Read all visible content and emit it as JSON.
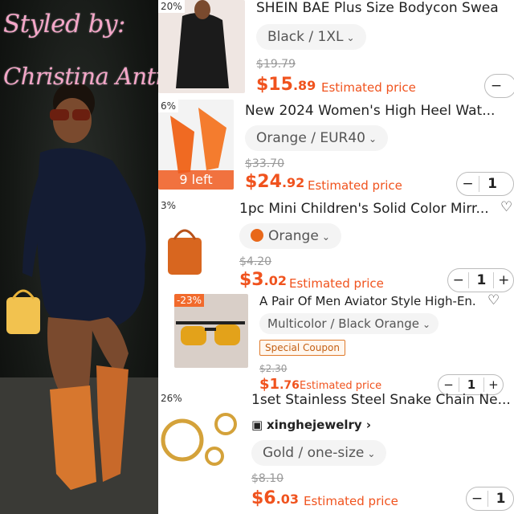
{
  "photo": {
    "caption_line1": "Styled by:",
    "caption_line2": "Christina Antionette"
  },
  "cart": {
    "items": [
      {
        "discount": "20%",
        "title": "SHEIN BAE Plus Size Bodycon Swea",
        "variant": "Black / 1XL",
        "original_price": "$19.79",
        "price_main": "$15",
        "price_cents": ".89",
        "estimated_label": "Estimated price",
        "qty_minus": "−"
      },
      {
        "discount": "6%",
        "stock_badge": "9 left",
        "title": "New 2024 Women's High Heel Wat...",
        "variant": "Orange / EUR40",
        "original_price": "$33.70",
        "price_main": "$24",
        "price_cents": ".92",
        "estimated_label": "Estimated price",
        "qty": "1"
      },
      {
        "discount": "3%",
        "title": "1pc Mini Children's Solid Color Mirr...",
        "variant": "Orange",
        "original_price": "$4.20",
        "price_main": "$3",
        "price_cents": ".02",
        "estimated_label": "Estimated price",
        "qty": "1"
      },
      {
        "discount": "-23%",
        "title": "A Pair Of Men Aviator Style High-En...",
        "variant": "Multicolor / Black Orange",
        "coupon": "Special Coupon",
        "original_price": "$2.30",
        "price_main": "$1",
        "price_cents": ".76",
        "estimated_label": "Estimated price",
        "qty": "1"
      },
      {
        "discount": "26%",
        "title": "1set Stainless Steel Snake Chain Ne...",
        "store": "xinghejewelry",
        "variant": "Gold / one-size",
        "original_price": "$8.10",
        "price_main": "$6",
        "price_cents": ".03",
        "estimated_label": "Estimated price",
        "qty": "1"
      }
    ]
  },
  "colors": {
    "accent": "#f0531e",
    "caption": "#f4a6c8",
    "variant_bg": "#f4f4f4"
  }
}
